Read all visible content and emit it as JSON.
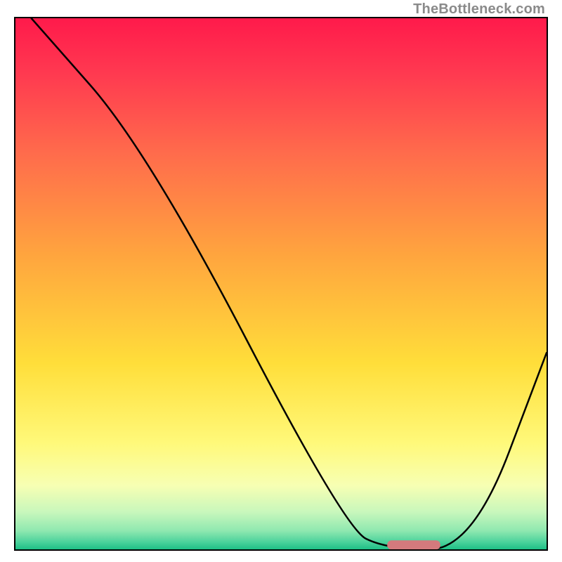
{
  "watermark": "TheBottleneck.com",
  "chart_data": {
    "type": "line",
    "title": "",
    "xlabel": "",
    "ylabel": "",
    "x_range": [
      0,
      100
    ],
    "y_range": [
      0,
      100
    ],
    "grid": false,
    "series": [
      {
        "name": "bottleneck-curve",
        "color": "#000000",
        "x": [
          3,
          25,
          62,
          70,
          86,
          100
        ],
        "y": [
          100,
          75,
          4,
          0,
          0,
          37
        ]
      }
    ],
    "highlight_segment": {
      "name": "optimal-range",
      "color": "#d47a7d",
      "x_start": 70,
      "x_end": 80,
      "y": 0.5
    },
    "background_gradient_stops": [
      {
        "offset": 0.0,
        "color": "#ff1a4b"
      },
      {
        "offset": 0.1,
        "color": "#ff3850"
      },
      {
        "offset": 0.25,
        "color": "#ff6a4c"
      },
      {
        "offset": 0.45,
        "color": "#ffa63e"
      },
      {
        "offset": 0.65,
        "color": "#ffde3a"
      },
      {
        "offset": 0.8,
        "color": "#fff97a"
      },
      {
        "offset": 0.88,
        "color": "#f7ffb3"
      },
      {
        "offset": 0.93,
        "color": "#c8f7bc"
      },
      {
        "offset": 0.965,
        "color": "#8fe8b0"
      },
      {
        "offset": 0.985,
        "color": "#4fd39d"
      },
      {
        "offset": 1.0,
        "color": "#1ebf86"
      }
    ]
  }
}
